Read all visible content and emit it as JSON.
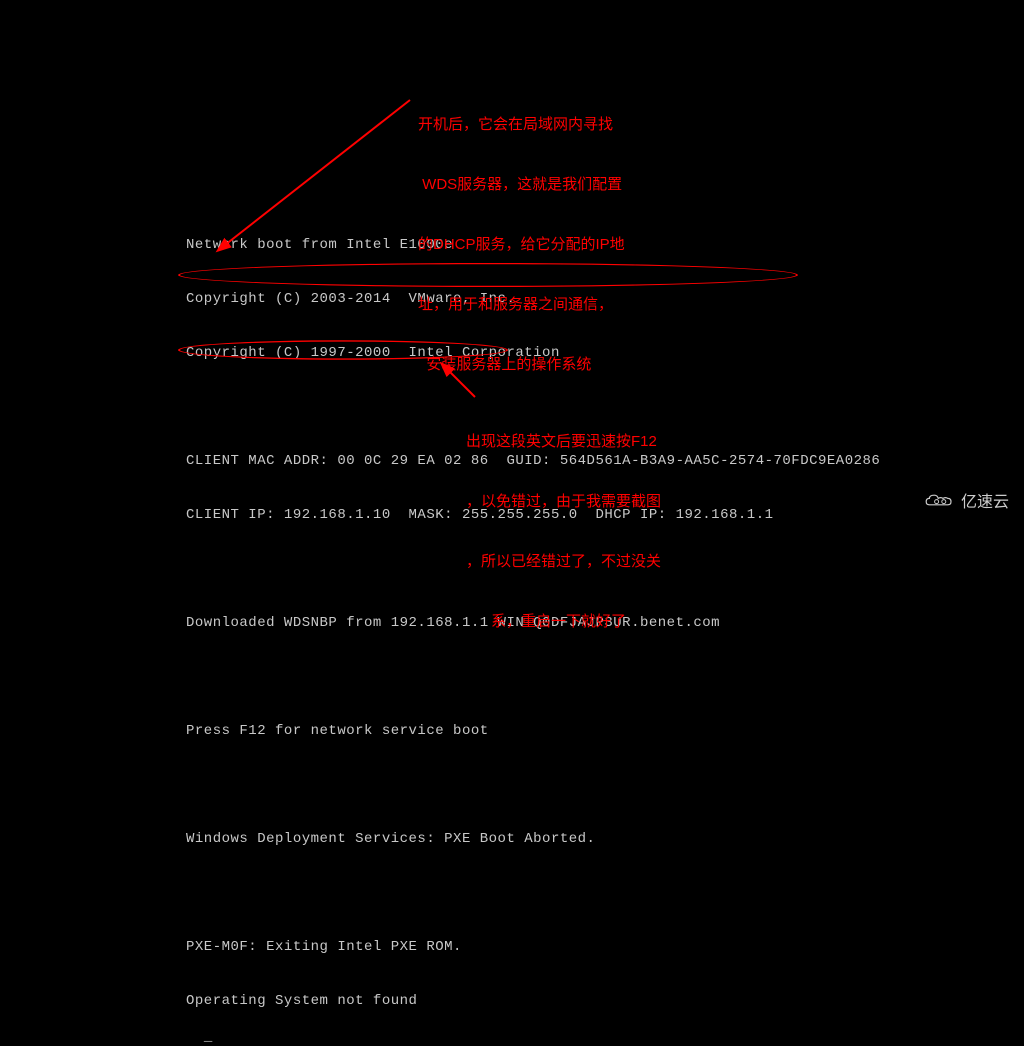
{
  "terminal": {
    "lines": {
      "network_boot": "Network boot from Intel E1000e",
      "copyright_vmware": "Copyright (C) 2003-2014  VMware, Inc.",
      "copyright_intel": "Copyright (C) 1997-2000  Intel Corporation",
      "client_mac": "CLIENT MAC ADDR: 00 0C 29 EA 02 86  GUID: 564D561A-B3A9-AA5C-2574-70FDC9EA0286",
      "client_ip": "CLIENT IP: 192.168.1.10  MASK: 255.255.255.0  DHCP IP: 192.168.1.1",
      "downloaded": "Downloaded WDSNBP from 192.168.1.1 WIN-Q0DFJAJP3UR.benet.com",
      "press_f12": "Press F12 for network service boot",
      "wds_aborted": "Windows Deployment Services: PXE Boot Aborted.",
      "pxe_exit": "PXE-M0F: Exiting Intel PXE ROM.",
      "os_not_found": "Operating System not found",
      "cursor": "_"
    }
  },
  "annotations": {
    "top": {
      "line1": "开机后，它会在局域网内寻找",
      "line2": " WDS服务器，这就是我们配置",
      "line3": "的DHCP服务，给它分配的IP地",
      "line4": "址，用于和服务器之间通信，",
      "line5": "  安装服务器上的操作系统"
    },
    "bottom": {
      "line1": "出现这段英文后要迅速按F12",
      "line2": "，以免错过，由于我需要截图",
      "line3": "，所以已经错过了，不过没关",
      "line4": "      系，重启一下就好了"
    }
  },
  "watermark": {
    "text": "亿速云"
  }
}
